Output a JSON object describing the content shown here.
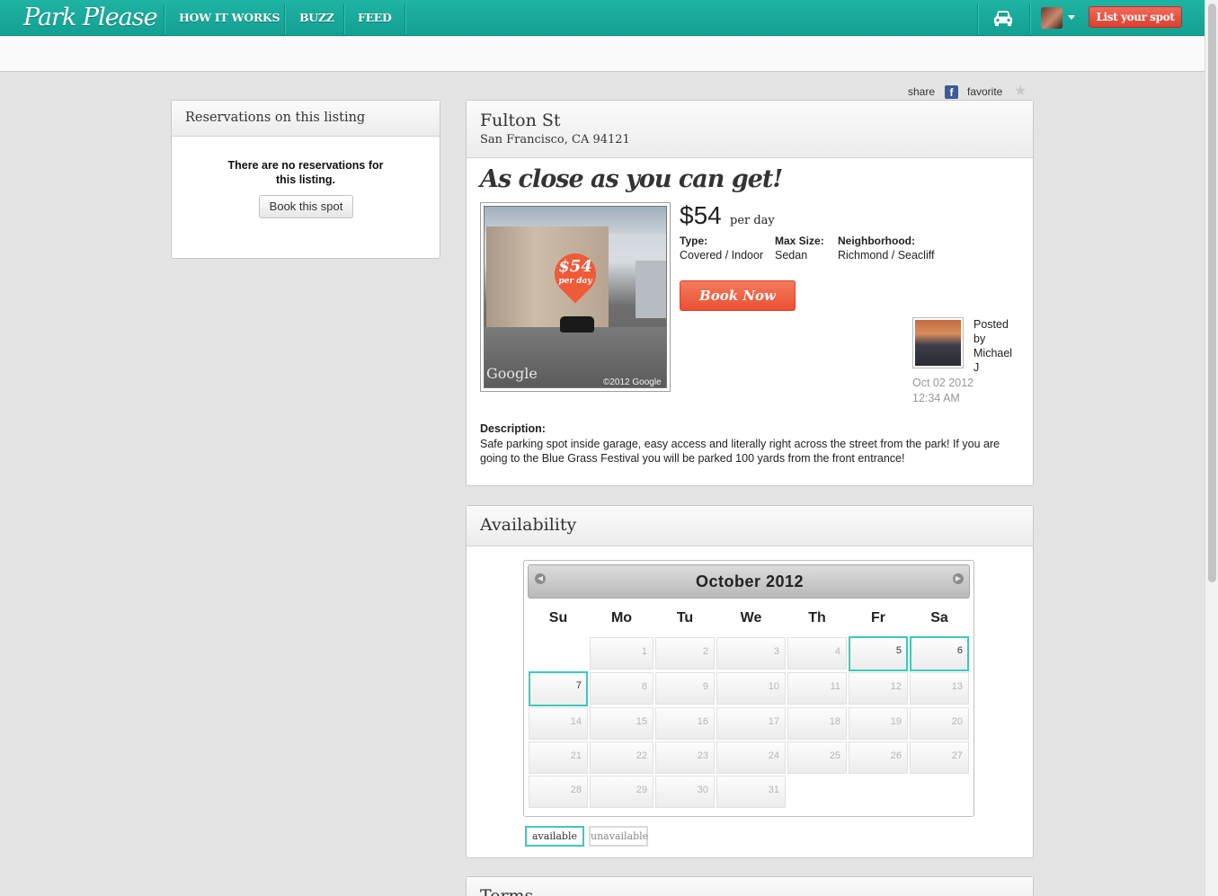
{
  "nav": {
    "logo": "Park Please",
    "links": [
      "HOW IT WORKS",
      "BUZZ",
      "FEED"
    ],
    "list_button": "List your spot"
  },
  "share": {
    "share_label": "share",
    "favorite_label": "favorite"
  },
  "reservations": {
    "title": "Reservations on this listing",
    "empty_message": "There are no reservations for this listing.",
    "book_button": "Book this spot"
  },
  "listing": {
    "street": "Fulton St",
    "city": "San Francisco, CA 94121",
    "headline": "As close as you can get!",
    "price": "$54",
    "price_unit": "per day",
    "photo_badge_price": "$54",
    "photo_badge_unit": "per day",
    "photo_watermark": "Google",
    "photo_copyright": "©2012 Google",
    "type_label": "Type:",
    "type_value": "Covered / Indoor",
    "size_label": "Max Size:",
    "size_value": "Sedan",
    "neighborhood_label": "Neighborhood:",
    "neighborhood_value": "Richmond / Seacliff",
    "book_now": "Book Now",
    "posted_by_lines": [
      "Posted",
      "by",
      "Michael",
      "J"
    ],
    "posted_date": "Oct 02 2012",
    "posted_time": "12:34 AM",
    "description_label": "Description:",
    "description": "Safe parking spot inside garage, easy access and literally right across the street from the park! If you are going to the Blue Grass Festival you will be parked 100 yards from the front entrance!"
  },
  "availability": {
    "title": "Availability",
    "month": "October 2012",
    "weekdays": [
      "Su",
      "Mo",
      "Tu",
      "We",
      "Th",
      "Fr",
      "Sa"
    ],
    "days_in_month": 31,
    "first_weekday": 1,
    "available_days": [
      5,
      6,
      7
    ],
    "legend_available": "available",
    "legend_unavailable": "unavailable"
  },
  "terms": {
    "title": "Terms"
  },
  "colors": {
    "brand": "#17a899",
    "accent": "#f0624d",
    "available": "#3fc8bb"
  }
}
